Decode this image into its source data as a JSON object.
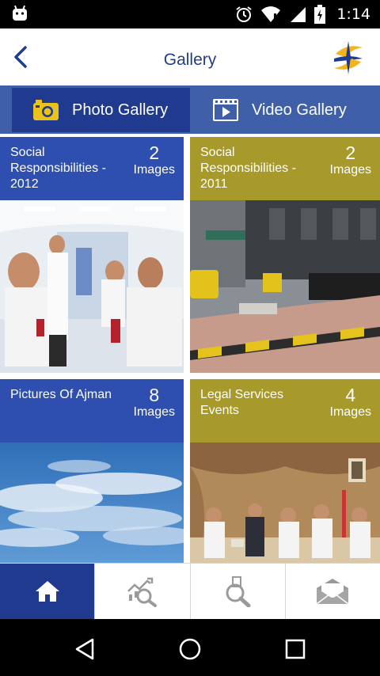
{
  "status_bar": {
    "time": "1:14",
    "icons": [
      "android-icon",
      "alarm-icon",
      "wifi-icon",
      "signal-icon",
      "battery-icon"
    ]
  },
  "header": {
    "title": "Gallery",
    "back_icon": "chevron-left-icon",
    "logo": "app-logo"
  },
  "tabs": [
    {
      "label": "Photo Gallery",
      "icon": "camera-icon",
      "selected": true
    },
    {
      "label": "Video Gallery",
      "icon": "video-icon",
      "selected": false
    }
  ],
  "albums": [
    {
      "title": "Social Responsibilities - 2012",
      "count": "2",
      "unit": "Images",
      "color": "#2e4fb0"
    },
    {
      "title": "Social Responsibilities - 2011",
      "count": "2",
      "unit": "Images",
      "color": "#a7992a"
    },
    {
      "title": "Pictures Of Ajman",
      "count": "8",
      "unit": "Images",
      "color": "#2e4fb0"
    },
    {
      "title": "Legal Services Events",
      "count": "4",
      "unit": "Images",
      "color": "#a7992a"
    }
  ],
  "bottom_nav": [
    {
      "icon": "home-icon",
      "selected": true
    },
    {
      "icon": "chart-search-icon",
      "selected": false
    },
    {
      "icon": "search-icon",
      "selected": false
    },
    {
      "icon": "mail-icon",
      "selected": false
    }
  ],
  "colors": {
    "primary_blue": "#1f3a8f",
    "tab_bar_blue": "#3f5fa8",
    "card_blue": "#2e4fb0",
    "card_olive": "#a7992a",
    "title_blue": "#213c8f"
  }
}
